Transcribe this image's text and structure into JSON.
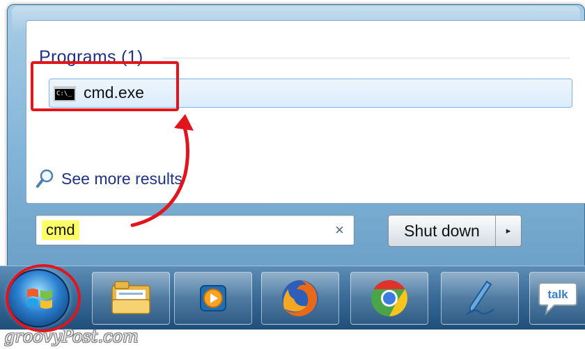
{
  "start_menu": {
    "section_title": "Programs (1)",
    "results": [
      {
        "label": "cmd.exe",
        "icon": "command-prompt-icon"
      }
    ],
    "see_more_label": "See more results",
    "search": {
      "value": "cmd",
      "clear_glyph": "×"
    },
    "shutdown": {
      "label": "Shut down",
      "arrow_glyph": "▸"
    }
  },
  "taskbar": {
    "start_icon": "windows-orb-icon",
    "pinned": [
      {
        "name": "windows-explorer",
        "icon": "folder-icon"
      },
      {
        "name": "media-player",
        "icon": "media-player-icon"
      },
      {
        "name": "firefox",
        "icon": "firefox-icon"
      },
      {
        "name": "chrome",
        "icon": "chrome-icon"
      },
      {
        "name": "live-writer",
        "icon": "pen-icon"
      },
      {
        "name": "google-talk",
        "icon": "talk-icon",
        "label": "talk"
      }
    ]
  },
  "watermark": "groovyPost.com",
  "colors": {
    "annotation": "#e2141c",
    "highlight": "#ffff66",
    "link": "#1e3287"
  }
}
